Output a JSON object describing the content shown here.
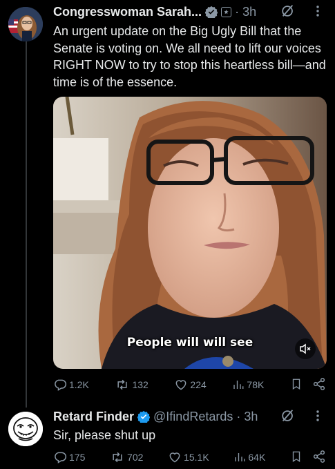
{
  "tweet1": {
    "author_name": "Congresswoman Sarah...",
    "time": "3h",
    "text": "An urgent update on the Big Ugly Bill that the Senate is voting on. We all need to lift our voices RIGHT NOW to try to stop this heartless bill—and time is of the essence.",
    "video_caption": "People will will see",
    "stats": {
      "replies": "1.2K",
      "reposts": "132",
      "likes": "224",
      "views": "78K"
    }
  },
  "tweet2": {
    "author_name": "Retard Finder",
    "handle": "@IfindRetards",
    "time": "3h",
    "text": "Sir, please shut up",
    "stats": {
      "replies": "175",
      "reposts": "702",
      "likes": "15.1K",
      "views": "64K"
    }
  },
  "colors": {
    "background": "#000000",
    "text": "#e7e9ea",
    "secondary": "#8b98a5",
    "verified": "#1d9bf0",
    "thread_line": "#333639"
  },
  "icons": [
    "verified-badge-icon",
    "government-flag-icon",
    "grok-icon",
    "more-icon",
    "reply-icon",
    "repost-icon",
    "like-icon",
    "views-icon",
    "bookmark-icon",
    "share-icon",
    "mute-icon"
  ]
}
